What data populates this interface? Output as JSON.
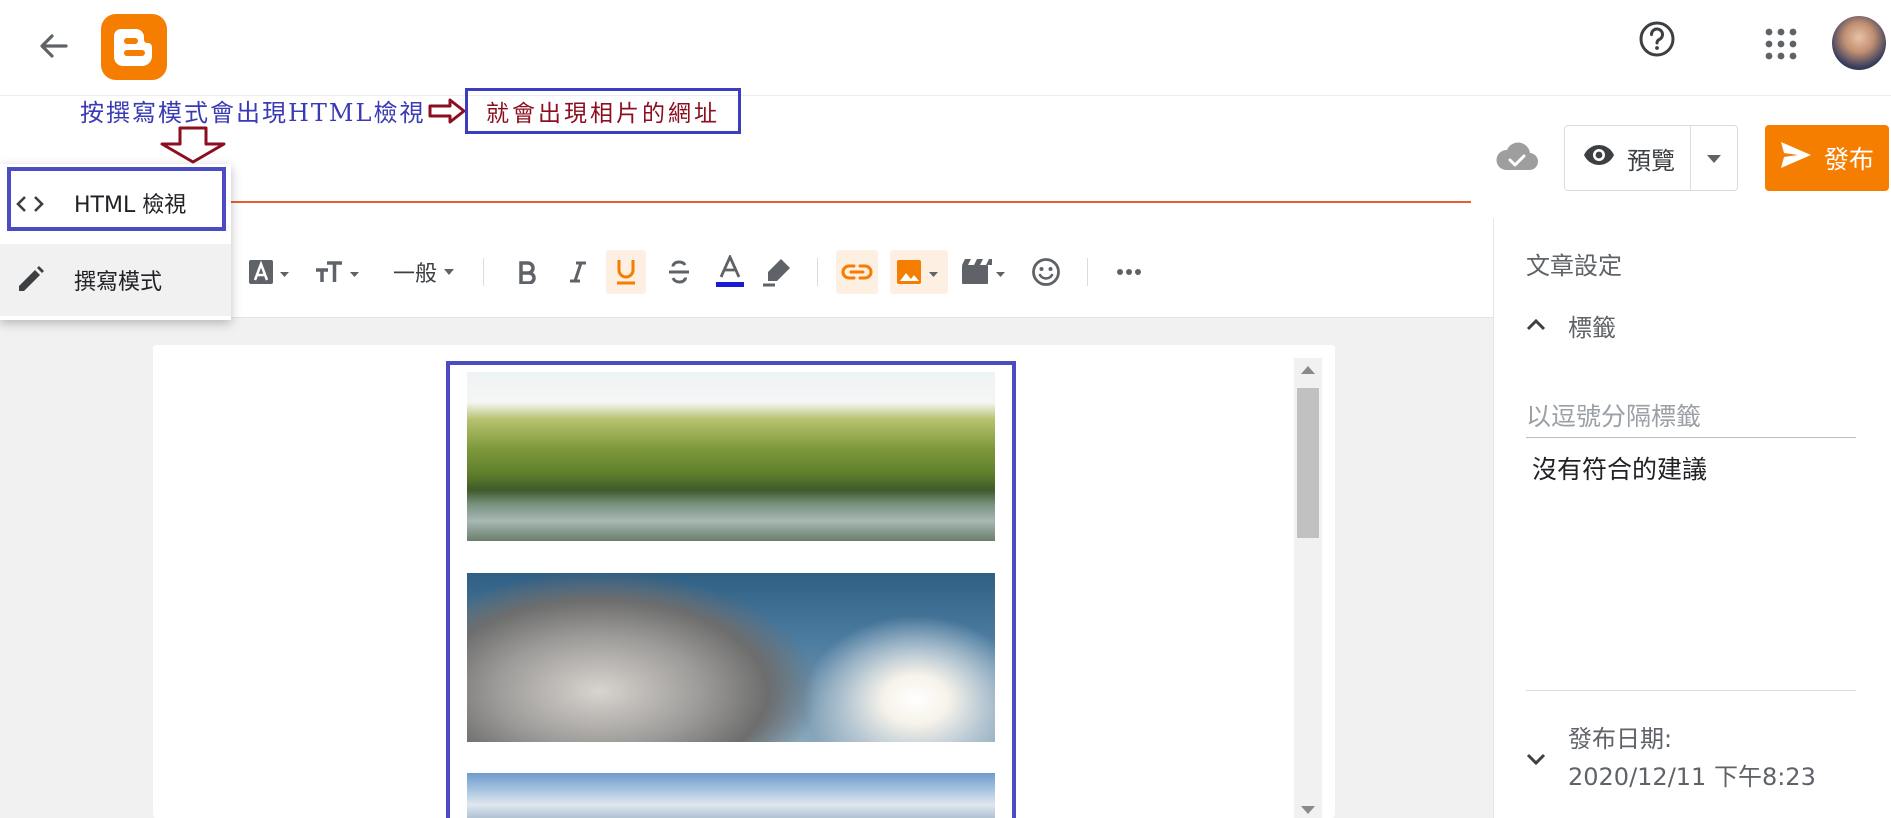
{
  "annotations": {
    "left_note": "按撰寫模式會出現HTML檢視",
    "boxed_note": "就會出現相片的網址"
  },
  "actions": {
    "preview_label": "預覽",
    "publish_label": "發布"
  },
  "toolbar": {
    "paragraph_style": "一般"
  },
  "mode_menu": {
    "html_view": "HTML 檢視",
    "compose_mode": "撰寫模式"
  },
  "settings": {
    "title": "文章設定",
    "labels_title": "標籤",
    "labels_placeholder": "以逗號分隔標籤",
    "labels_empty": "沒有符合的建議",
    "publish_date_label": "發布日期:",
    "publish_date_value": "2020/12/11 下午8:23"
  },
  "colors": {
    "brand": "#f57d00",
    "title_underline": "#e95d32",
    "annotation_border": "#3d3dc0",
    "annotation_red": "#8b0f1f",
    "text_color_swatch": "#1a1ad9"
  },
  "icons": [
    "back-arrow-icon",
    "blogger-logo",
    "help-icon",
    "apps-grid-icon",
    "cloud-saved-icon",
    "eye-icon",
    "chevron-down-icon",
    "send-icon",
    "code-icon",
    "pencil-icon",
    "font-icon",
    "text-size-icon",
    "bold-icon",
    "italic-icon",
    "underline-icon",
    "strikethrough-icon",
    "text-color-icon",
    "highlight-icon",
    "link-icon",
    "image-icon",
    "video-icon",
    "emoji-icon",
    "more-icon",
    "chevron-up-icon"
  ]
}
